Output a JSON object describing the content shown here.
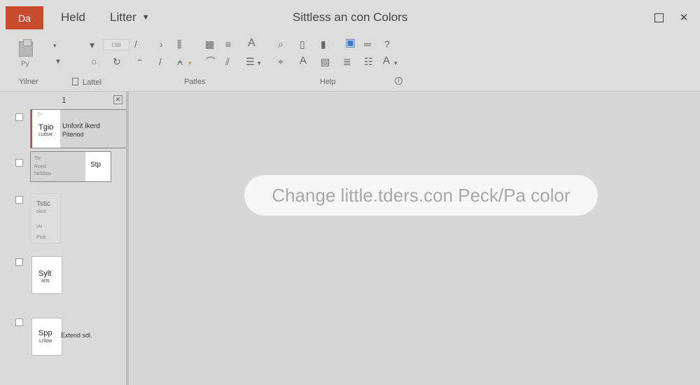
{
  "titlebar": {
    "app_badge": "Da",
    "tabs": [
      {
        "label": "Held",
        "has_chevron": false
      },
      {
        "label": "Litter",
        "has_chevron": true
      }
    ],
    "doc_title": "Sittless an con Colors"
  },
  "ribbon": {
    "paste_label": "Py",
    "font_box_text": "I:iili",
    "groups": {
      "g1": "Yilner",
      "g2": "Lattel",
      "g3": "Patles",
      "g4": "Help"
    },
    "font_glyph": "A",
    "font_size_glyph": "A"
  },
  "slide_pane": {
    "number": "1",
    "slides": [
      {
        "big": "Tgio",
        "small": "Lutlsie",
        "side_top": "Unforit ikerd",
        "side_bottom": "Pitenod"
      },
      {
        "faint1": "Tsr",
        "faint2": "Roed",
        "faint3": "helldatu",
        "big": "Stp"
      },
      {
        "big": "Tstic",
        "faint1": "sklst",
        "faint2": "uu",
        "faint3": "Pislt"
      },
      {
        "big": "Sylt",
        "small": "arts"
      },
      {
        "big": "Spp",
        "small": "Lrilow",
        "side": "Extend sdl."
      }
    ]
  },
  "canvas": {
    "hint": "Change little.tders.con Peck/Pa color"
  }
}
